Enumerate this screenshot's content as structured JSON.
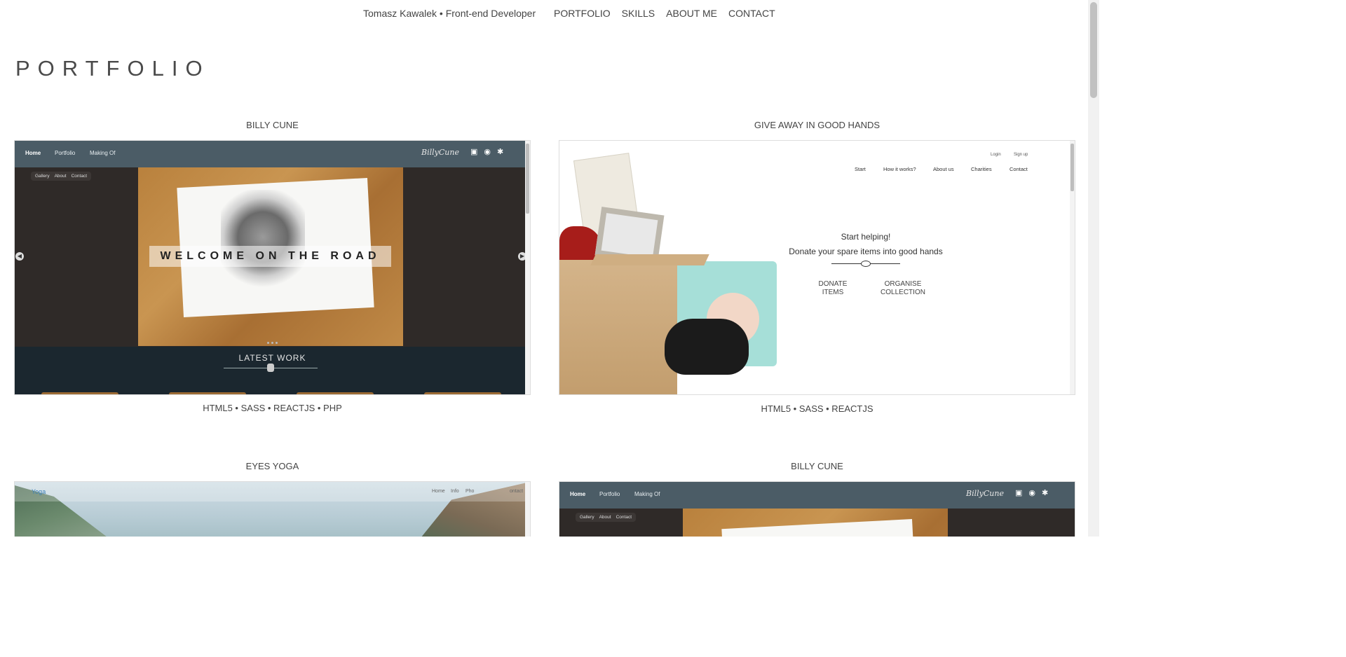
{
  "nav": {
    "brand": "Tomasz Kawalek • Front-end Developer",
    "items": [
      "PORTFOLIO",
      "SKILLS",
      "ABOUT ME",
      "CONTACT"
    ]
  },
  "page_title": "PORTFOLIO",
  "projects": [
    {
      "title": "BILLY CUNE",
      "tech": "HTML5 • SASS • REACTJS • PHP",
      "mock": {
        "nav": [
          "Home",
          "Portfolio",
          "Making Of"
        ],
        "logo": "BillyCune",
        "subnav": [
          "Gallery",
          "About",
          "Contact"
        ],
        "hero_text": "WELCOME ON THE ROAD",
        "section": "LATEST WORK"
      }
    },
    {
      "title": "GIVE AWAY IN GOOD HANDS",
      "tech": "HTML5 • SASS • REACTJS",
      "mock": {
        "auth": [
          "Login",
          "Sign up"
        ],
        "menu": [
          "Start",
          "How it works?",
          "About us",
          "Charities",
          "Contact"
        ],
        "heading1": "Start helping!",
        "heading2": "Donate your spare items into good hands",
        "btn1_l1": "DONATE",
        "btn1_l2": "ITEMS",
        "btn2_l1": "ORGANISE",
        "btn2_l2": "COLLECTION"
      }
    },
    {
      "title": "EYES YOGA",
      "mock": {
        "logo": "Yoga",
        "links": [
          "Home",
          "Info",
          "Pho",
          "",
          "ontact"
        ]
      }
    },
    {
      "title": "BILLY CUNE",
      "mock": {
        "nav": [
          "Home",
          "Portfolio",
          "Making Of"
        ],
        "logo": "BillyCune",
        "subnav": [
          "Gallery",
          "About",
          "Contact"
        ]
      }
    }
  ],
  "icons": {
    "social": [
      "facebook-icon",
      "instagram-icon",
      "deviantart-icon"
    ]
  }
}
